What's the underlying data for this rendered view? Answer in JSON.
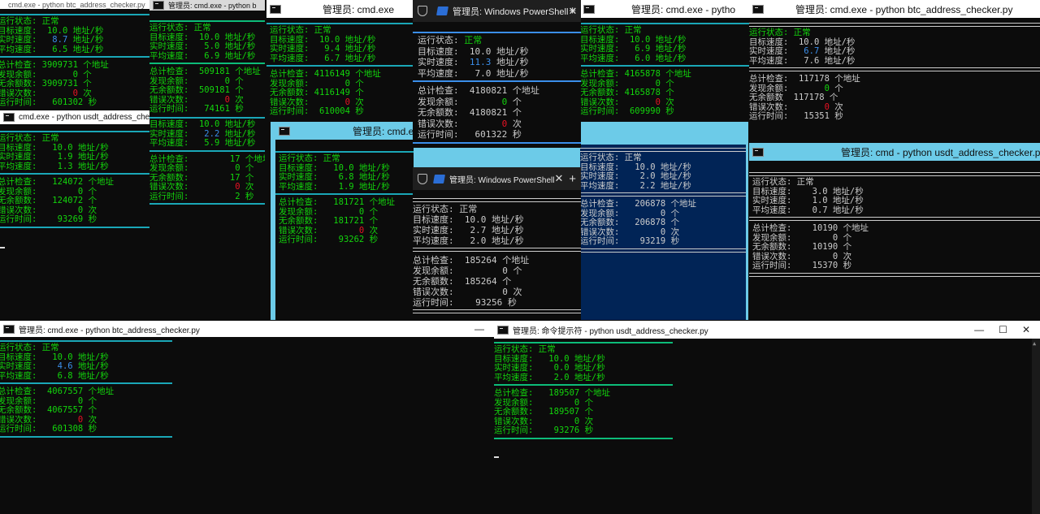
{
  "labels": {
    "status": "运行状态:",
    "target": "目标速度:",
    "realtime": "实时速度:",
    "avg": "平均速度:",
    "total": "总计检查:",
    "found": "发现余额:",
    "no_balance": "无余额数:",
    "errors": "错误次数:",
    "runtime": "运行时间:",
    "no_balance_alt": "无余额数"
  },
  "units": {
    "speed": "地址/秒",
    "addr": "个地址",
    "count": "个",
    "times": "次",
    "sec": "秒"
  },
  "status_ok": "正常",
  "windows": [
    {
      "id": "w1",
      "title": "cmd.exe - python  btc_address_checker.py",
      "target": "10.0",
      "rt": "8.7",
      "avg": "6.5",
      "total": "3909731",
      "found": "0",
      "nobal": "3909731",
      "err": "0",
      "time": "601302"
    },
    {
      "id": "w2",
      "title": "管理员: cmd.exe - python  b",
      "target": "10.0",
      "rt": "5.0",
      "avg": "6.9",
      "total": "509181",
      "found": "0",
      "nobal": "509181",
      "err": "0",
      "time": "74161"
    },
    {
      "id": "w3",
      "title": "管理员: cmd.exe",
      "target": "10.0",
      "rt": "9.4",
      "avg": "6.7",
      "total": "4116149",
      "found": "0",
      "nobal": "4116149",
      "err": "0",
      "time": "610004"
    },
    {
      "id": "w4",
      "title": "管理员: Windows PowerShell",
      "target": "10.0",
      "rt": "11.3",
      "avg": "7.0",
      "total": "4180821",
      "found": "0",
      "nobal": "4180821",
      "err": "0",
      "time": "601322"
    },
    {
      "id": "w5",
      "title": "管理员: cmd.exe - pytho",
      "target": "10.0",
      "rt": "6.9",
      "avg": "6.0",
      "total": "4165878",
      "found": "0",
      "nobal": "4165878",
      "err": "0",
      "time": "609990"
    },
    {
      "id": "w6",
      "title": "管理员: cmd.exe - python  btc_address_checker.py",
      "target": "10.0",
      "rt": "6.7",
      "avg": "7.6",
      "total": "117178",
      "found": "0",
      "nobal": "117178",
      "err": "0",
      "time": "15351"
    },
    {
      "id": "w7",
      "title": "cmd.exe - python  usdt_address_checker.py",
      "target": "10.0",
      "rt": "1.9",
      "avg": "1.3",
      "total": "124072",
      "found": "0",
      "nobal": "124072",
      "err": "0",
      "time": "93269"
    },
    {
      "id": "w8",
      "title": "",
      "target": "10.0",
      "rt": "2.2",
      "avg": "5.9",
      "total": "17",
      "found": "0",
      "nobal": "17",
      "err": "0",
      "time": "2"
    },
    {
      "id": "w9",
      "title": "管理员: cmd.e",
      "target": "10.0",
      "rt": "6.8",
      "avg": "1.9",
      "total": "181721",
      "found": "0",
      "nobal": "181721",
      "err": "0",
      "time": "93262"
    },
    {
      "id": "w10",
      "title": "管理员: Windows PowerShell",
      "target": "10.0",
      "rt": "2.7",
      "avg": "2.0",
      "total": "185264",
      "found": "0",
      "nobal": "185264",
      "err": "0",
      "time": "93256"
    },
    {
      "id": "w11",
      "title": "",
      "target": "10.0",
      "rt": "2.0",
      "avg": "2.2",
      "total": "206878",
      "found": "0",
      "nobal": "206878",
      "err": "0",
      "time": "93219"
    },
    {
      "id": "w12",
      "title": "管理员: cmd - python  usdt_address_checker.py",
      "target": "3.0",
      "rt": "1.0",
      "avg": "0.7",
      "total": "10190",
      "found": "0",
      "nobal": "10190",
      "err": "0",
      "time": "15370"
    },
    {
      "id": "w13",
      "title": "管理员: cmd.exe - python  btc_address_checker.py",
      "target": "10.0",
      "rt": "4.6",
      "avg": "6.8",
      "total": "4067557",
      "found": "0",
      "nobal": "4067557",
      "err": "0",
      "time": "601308"
    },
    {
      "id": "w14",
      "title": "管理员: 命令提示符 - python  usdt_address_checker.py",
      "target": "10.0",
      "rt": "0.0",
      "avg": "2.0",
      "total": "189507",
      "found": "0",
      "nobal": "189507",
      "err": "0",
      "time": "93276"
    }
  ],
  "controls": {
    "minimize": "—",
    "maximize": "☐",
    "close": "✕",
    "tab_close": "✕",
    "tab_new": "+"
  }
}
